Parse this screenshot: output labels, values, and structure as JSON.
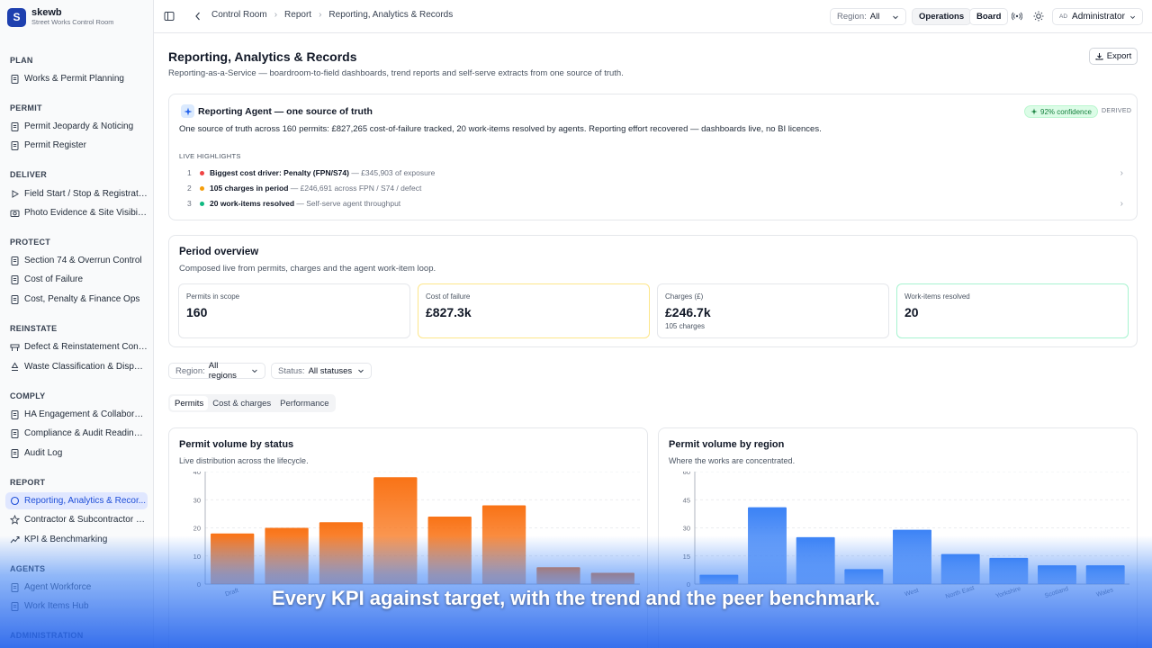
{
  "brand": {
    "logo_letter": "S",
    "name": "skewb",
    "subtitle": "Street Works Control Room"
  },
  "sidebar": {
    "sections": [
      "PLAN",
      "PERMIT",
      "DELIVER",
      "PROTECT",
      "REINSTATE",
      "COMPLY",
      "REPORT",
      "AGENTS",
      "ADMINISTRATION"
    ],
    "items": [
      {
        "label": "Works & Permit Planning",
        "icon": "clipboard-icon"
      },
      {
        "label": "Permit Jeopardy & Noticing",
        "icon": "clipboard-icon"
      },
      {
        "label": "Permit Register",
        "icon": "clipboard-icon"
      },
      {
        "label": "Field Start / Stop & Registrati...",
        "icon": "play-icon"
      },
      {
        "label": "Photo Evidence & Site Visibility",
        "icon": "camera-icon"
      },
      {
        "label": "Section 74 & Overrun Control",
        "icon": "clipboard-icon"
      },
      {
        "label": "Cost of Failure",
        "icon": "clipboard-icon"
      },
      {
        "label": "Cost, Penalty & Finance Ops",
        "icon": "clipboard-icon"
      },
      {
        "label": "Defect & Reinstatement Contr...",
        "icon": "barrier-icon"
      },
      {
        "label": "Waste Classification & Dispos...",
        "icon": "recycle-icon"
      },
      {
        "label": "HA Engagement & Collaborati...",
        "icon": "clipboard-icon"
      },
      {
        "label": "Compliance & Audit Readiness",
        "icon": "clipboard-icon"
      },
      {
        "label": "Audit Log",
        "icon": "clipboard-icon"
      },
      {
        "label": "Reporting, Analytics & Recor...",
        "icon": "circle-icon"
      },
      {
        "label": "Contractor & Subcontractor P...",
        "icon": "star-icon"
      },
      {
        "label": "KPI & Benchmarking",
        "icon": "trend-icon"
      },
      {
        "label": "Agent Workforce",
        "icon": "clipboard-icon"
      },
      {
        "label": "Work Items Hub",
        "icon": "clipboard-icon"
      }
    ]
  },
  "topbar": {
    "breadcrumb": [
      "Control Room",
      "Report",
      "Reporting, Analytics & Records"
    ],
    "region_label": "Region:",
    "region_value": "All",
    "operations": "Operations",
    "board": "Board",
    "user_initials": "AD",
    "user": "Administrator"
  },
  "page": {
    "title": "Reporting, Analytics & Records",
    "subtitle": "Reporting-as-a-Service — boardroom-to-field dashboards, trend reports and self-serve extracts from one source of truth.",
    "export": "Export"
  },
  "agent": {
    "title": "Reporting Agent — one source of truth",
    "confidence": "92% confidence",
    "derived": "DERIVED",
    "summary": "One source of truth across 160 permits: £827,265 cost-of-failure tracked, 20 work-items resolved by agents. Reporting effort recovered — dashboards live, no BI licences.",
    "highlights_label": "LIVE HIGHLIGHTS",
    "highlights": [
      {
        "n": "1",
        "main": "Biggest cost driver: Penalty (FPN/S74)",
        "sub": "— £345,903 of exposure",
        "color": "#ef4444"
      },
      {
        "n": "2",
        "main": "105 charges in period",
        "sub": "— £246,691 across FPN / S74 / defect",
        "color": "#f59e0b"
      },
      {
        "n": "3",
        "main": "20 work-items resolved",
        "sub": "— Self-serve agent throughput",
        "color": "#10b981"
      }
    ]
  },
  "overview": {
    "title": "Period overview",
    "subtitle": "Composed live from permits, charges and the agent work-item loop.",
    "kpis": [
      {
        "label": "Permits in scope",
        "value": "160",
        "note": "",
        "border": "#e5e7eb"
      },
      {
        "label": "Cost of failure",
        "value": "£827.3k",
        "note": "",
        "border": "#fde68a"
      },
      {
        "label": "Charges (£)",
        "value": "£246.7k",
        "note": "105 charges",
        "border": "#e5e7eb"
      },
      {
        "label": "Work-items resolved",
        "value": "20",
        "note": "",
        "border": "#a7f3d0"
      }
    ]
  },
  "filters": {
    "region_label": "Region:",
    "region_value": "All regions",
    "status_label": "Status:",
    "status_value": "All statuses"
  },
  "tabs": [
    "Permits",
    "Cost & charges",
    "Performance"
  ],
  "charts": {
    "status": {
      "title": "Permit volume by status",
      "subtitle": "Live distribution across the lifecycle."
    },
    "region": {
      "title": "Permit volume by region",
      "subtitle": "Where the works are concentrated."
    }
  },
  "chart_data": [
    {
      "type": "bar",
      "title": "Permit volume by status",
      "categories": [
        "Draft",
        "",
        "",
        "",
        "",
        "",
        "",
        ""
      ],
      "values": [
        18,
        20,
        22,
        38,
        24,
        28,
        6,
        4
      ],
      "ylim": [
        0,
        40
      ],
      "yticks": [
        0,
        10,
        20,
        30,
        40
      ],
      "color": "#f97316",
      "grid": true
    },
    {
      "type": "bar",
      "title": "Permit volume by region",
      "categories": [
        "",
        "",
        "",
        "",
        "West",
        "North East",
        "Yorkshire",
        "Scotland",
        "Wales"
      ],
      "values": [
        5,
        41,
        25,
        8,
        29,
        16,
        14,
        10,
        10
      ],
      "ylim": [
        0,
        60
      ],
      "yticks": [
        0,
        15,
        30,
        45,
        60
      ],
      "color": "#3b82f6",
      "grid": true
    }
  ],
  "caption": "Every KPI against target, with the trend and the peer benchmark."
}
